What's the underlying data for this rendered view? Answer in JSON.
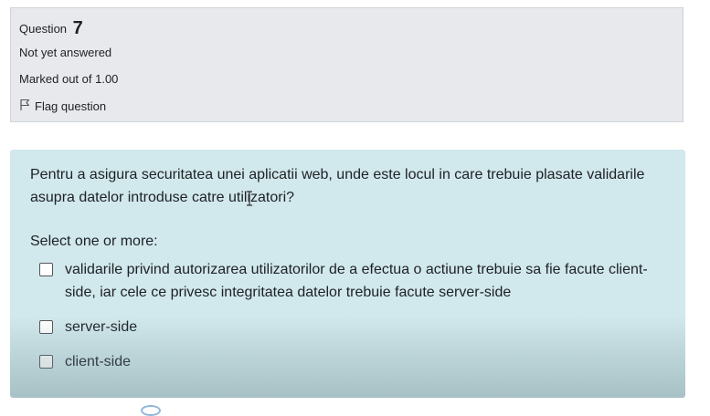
{
  "question_info": {
    "label": "Question",
    "number": "7",
    "state": "Not yet answered",
    "marks": "Marked out of 1.00",
    "flag_label": "Flag question"
  },
  "question": {
    "text": "Pentru a asigura securitatea unei aplicatii web, unde este locul in care trebuie plasate validarile asupra datelor introduse catre utilizatori?",
    "prompt": "Select one or more:",
    "options": [
      {
        "label": "validarile privind autorizarea utilizatorilor de a efectua o actiune trebuie sa fie facute client-side, iar cele ce privesc integritatea datelor trebuie facute server-side",
        "checked": false
      },
      {
        "label": "server-side",
        "checked": false
      },
      {
        "label": "client-side",
        "checked": false
      }
    ]
  },
  "icons": {
    "flag": "flag-icon",
    "checkbox": "checkbox-icon",
    "cursor": "text-cursor-icon"
  },
  "colors": {
    "info_bg": "#e7e9ec",
    "content_bg": "#d1e8ec",
    "text": "#1d2125"
  }
}
